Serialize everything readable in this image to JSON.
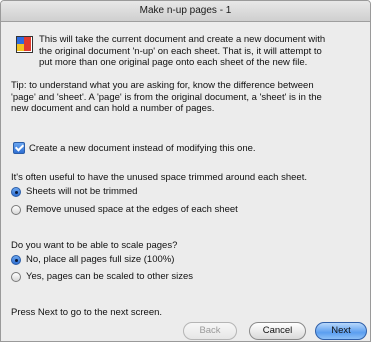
{
  "window": {
    "title": "Make n-up pages - 1"
  },
  "intro": {
    "icon": "n-up-pages-icon",
    "line1": "This will take the current document and create a new document with",
    "line2": "the original document 'n-up' on each sheet.  That is, it will attempt to",
    "line3": "put more than one original page onto each sheet of the new file."
  },
  "tip": {
    "line1": "Tip: to understand what you are asking for, know the difference between",
    "line2": "'page' and 'sheet'.  A 'page' is from the original document, a 'sheet' is in the",
    "line3": "new document and can hold a number of pages."
  },
  "create_new": {
    "label": "Create a new document instead of modifying this one.",
    "checked": true
  },
  "trim": {
    "question": "It's often useful to have the unused space trimmed around each sheet.",
    "options": [
      {
        "label": "Sheets will not be trimmed",
        "selected": true
      },
      {
        "label": "Remove unused space at the edges of each sheet",
        "selected": false
      }
    ]
  },
  "scale": {
    "question": "Do you want to be able to scale pages?",
    "options": [
      {
        "label": "No, place all pages full size (100%)",
        "selected": true
      },
      {
        "label": "Yes, pages can be scaled to other sizes",
        "selected": false
      }
    ]
  },
  "footer": {
    "hint": "Press Next to go to the next screen.",
    "back": "Back",
    "cancel": "Cancel",
    "next": "Next"
  },
  "colors": {
    "accent": "#3d82e6",
    "window_bg": "#ececec"
  }
}
